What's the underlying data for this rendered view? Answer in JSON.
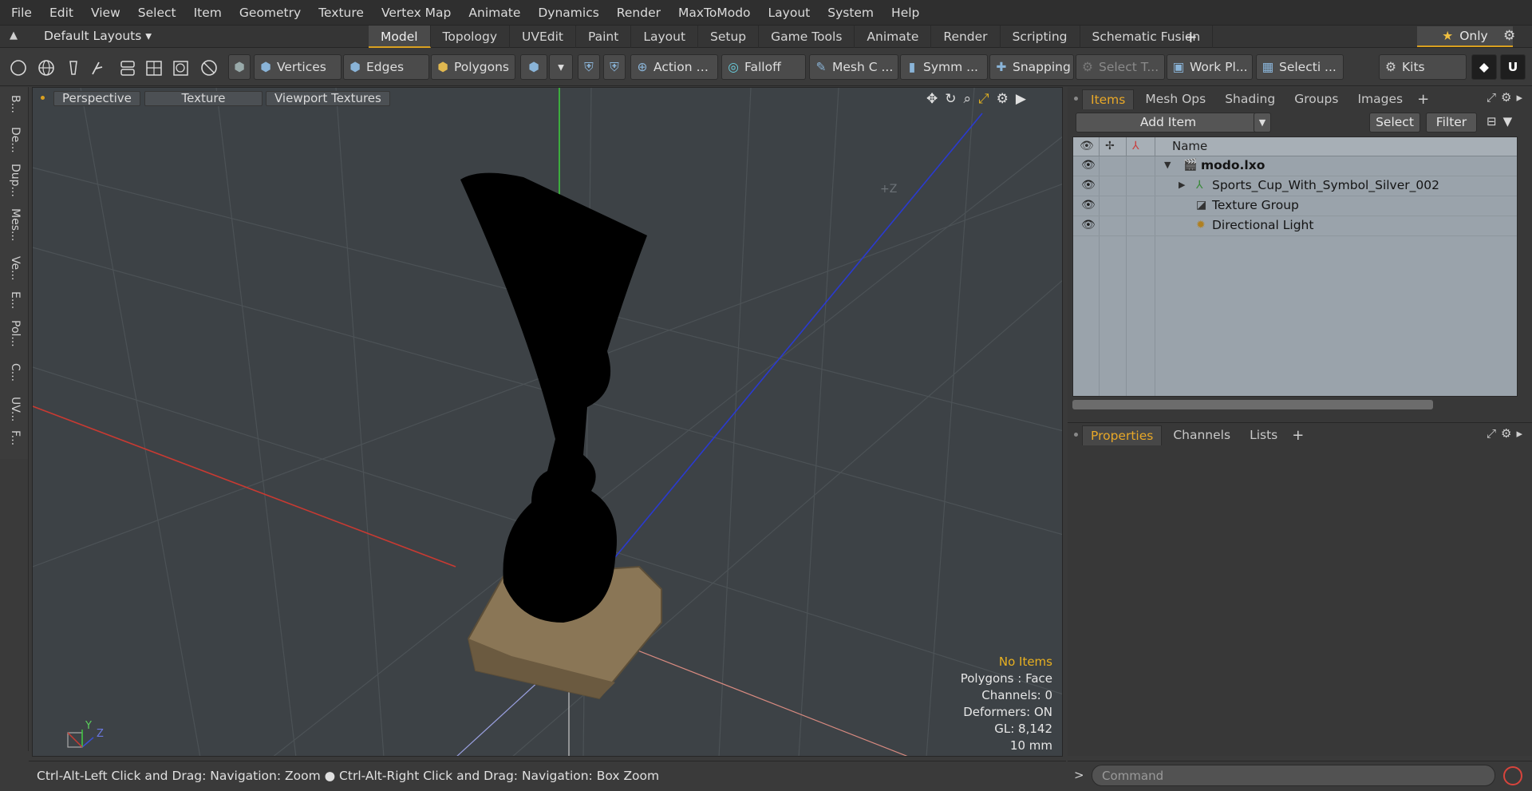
{
  "menu": [
    "File",
    "Edit",
    "View",
    "Select",
    "Item",
    "Geometry",
    "Texture",
    "Vertex Map",
    "Animate",
    "Dynamics",
    "Render",
    "MaxToModo",
    "Layout",
    "System",
    "Help"
  ],
  "layout": {
    "default_label": "Default Layouts ▾",
    "tabs": [
      "Model",
      "Topology",
      "UVEdit",
      "Paint",
      "Layout",
      "Setup",
      "Game Tools",
      "Animate",
      "Render",
      "Scripting",
      "Schematic Fusion"
    ],
    "active_tab": "Model",
    "only_label": "Only"
  },
  "toolbar": {
    "vertices": "Vertices",
    "edges": "Edges",
    "polygons": "Polygons",
    "action": "Action",
    "falloff": "Falloff",
    "mesh": "Mesh C ...",
    "symm": "Symm ...",
    "snapping": "Snapping",
    "select_t": "Select T...",
    "work_pl": "Work Pl...",
    "selecti": "Selecti ...",
    "kits": "Kits"
  },
  "left_tools": [
    "B...",
    "De...",
    "Dup...",
    "Mes...",
    "Ve...",
    "E...",
    "Pol...",
    "C...",
    "UV...",
    "F..."
  ],
  "viewport": {
    "perspective": "Perspective",
    "texture": "Texture",
    "viewport_textures": "Viewport Textures",
    "z_label": "+Z",
    "gizmo_y": "Y",
    "gizmo_z": "Z",
    "info": {
      "no_items": "No Items",
      "polygons": "Polygons : Face",
      "channels": "Channels: 0",
      "deformers": "Deformers: ON",
      "gl": "GL: 8,142",
      "scale": "10 mm"
    }
  },
  "status": "Ctrl-Alt-Left Click and Drag: Navigation: Zoom ● Ctrl-Alt-Right Click and Drag: Navigation: Box Zoom",
  "items_panel": {
    "tabs": [
      "Items",
      "Mesh Ops",
      "Shading",
      "Groups",
      "Images"
    ],
    "active_tab": "Items",
    "add_item": "Add Item",
    "select": "Select",
    "filter": "Filter",
    "name_header": "Name",
    "rows": [
      {
        "label": "modo.lxo",
        "bold": true
      },
      {
        "label": "Sports_Cup_With_Symbol_Silver_002",
        "bold": false
      },
      {
        "label": "Texture Group",
        "bold": false
      },
      {
        "label": "Directional Light",
        "bold": false
      }
    ]
  },
  "props_panel": {
    "tabs": [
      "Properties",
      "Channels",
      "Lists"
    ],
    "active_tab": "Properties"
  },
  "command": {
    "prompt": ">",
    "placeholder": "Command"
  },
  "colors": {
    "accent": "#d9a020",
    "axis_x": "#c83a32",
    "axis_y": "#3cc83c",
    "axis_z": "#2a3ad0"
  }
}
